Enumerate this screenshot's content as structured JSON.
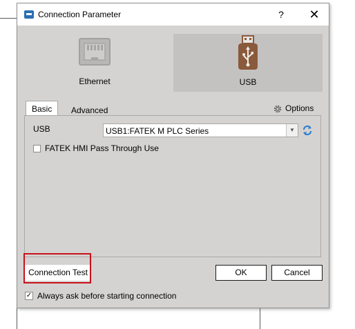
{
  "window": {
    "title": "Connection Parameter",
    "help_glyph": "?",
    "close_glyph": "✕"
  },
  "connection_types": [
    {
      "label": "Ethernet",
      "icon": "ethernet-port-icon",
      "selected": false
    },
    {
      "label": "USB",
      "icon": "usb-drive-icon",
      "selected": true
    }
  ],
  "tabs": [
    {
      "label": "Basic",
      "active": true
    },
    {
      "label": "Advanced",
      "active": false
    }
  ],
  "options_label": "Options",
  "basic": {
    "usb_label": "USB",
    "usb_device_value": "USB1:FATEK M PLC Series",
    "hmi_pass_through_label": "FATEK HMI Pass Through Use",
    "hmi_pass_through_checked": false
  },
  "buttons": {
    "connection_test": "Connection Test",
    "ok": "OK",
    "cancel": "Cancel"
  },
  "always_ask": {
    "label": "Always ask before starting connection",
    "checked": true,
    "check_glyph": "✓"
  },
  "colors": {
    "dialog_bg": "#d5d3d1",
    "selected_tile_bg": "#c4c2c1",
    "highlight_border": "#c8101a",
    "usb_icon_brown": "#8a5a3c",
    "refresh_blue": "#2f7fd0"
  }
}
